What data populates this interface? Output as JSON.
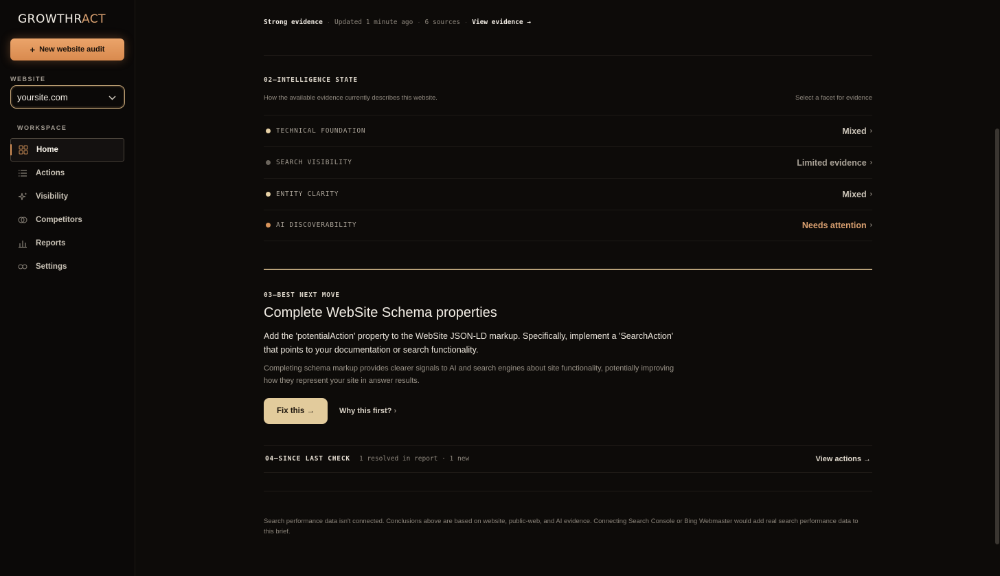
{
  "brand": {
    "name_part1": "GROWTHR",
    "name_accent": "ACT"
  },
  "sidebar": {
    "new_audit_label": "New website audit",
    "website_label": "WEBSITE",
    "website_value": "yoursite.com",
    "workspace_label": "WORKSPACE",
    "items": [
      {
        "label": "Home",
        "icon": "grid-icon"
      },
      {
        "label": "Actions",
        "icon": "list-icon"
      },
      {
        "label": "Visibility",
        "icon": "sparkle-icon"
      },
      {
        "label": "Competitors",
        "icon": "overlap-circles-icon"
      },
      {
        "label": "Reports",
        "icon": "bar-chart-icon"
      },
      {
        "label": "Settings",
        "icon": "infinity-icon"
      }
    ]
  },
  "evidence": {
    "strength": "Strong evidence",
    "updated": "Updated 1 minute ago",
    "sources": "6 sources",
    "view_link": "View evidence →"
  },
  "intelligence": {
    "title": "02—INTELLIGENCE STATE",
    "subtitle": "How the available evidence currently describes this website.",
    "hint": "Select a facet for evidence",
    "facets": [
      {
        "name": "TECHNICAL FOUNDATION",
        "status": "Mixed",
        "dot_color": "#e8d2a6",
        "status_color": "#c9c2b6"
      },
      {
        "name": "SEARCH VISIBILITY",
        "status": "Limited evidence",
        "dot_color": "#6b655d",
        "status_color": "#a8a196"
      },
      {
        "name": "ENTITY CLARITY",
        "status": "Mixed",
        "dot_color": "#e8d2a6",
        "status_color": "#c9c2b6"
      },
      {
        "name": "AI DISCOVERABILITY",
        "status": "Needs attention",
        "dot_color": "#d9945a",
        "status_color": "#d9a070"
      }
    ]
  },
  "best_move": {
    "title": "03—BEST NEXT MOVE",
    "headline": "Complete WebSite Schema properties",
    "description": "Add the 'potentialAction' property to the WebSite JSON-LD markup. Specifically, implement a 'SearchAction' that points to your documentation or search functionality.",
    "note": "Completing schema markup provides clearer signals to AI and search engines about site functionality, potentially improving how they represent your site in answer results.",
    "fix_label": "Fix this →",
    "why_label": "Why this first?"
  },
  "since_last": {
    "title": "04—SINCE LAST CHECK",
    "detail": "1 resolved in report · 1 new",
    "view_actions": "View actions →"
  },
  "footnote": "Search performance data isn't connected. Conclusions above are based on website, public-web, and AI evidence. Connecting Search Console or Bing Webmaster would add real search performance data to this brief."
}
